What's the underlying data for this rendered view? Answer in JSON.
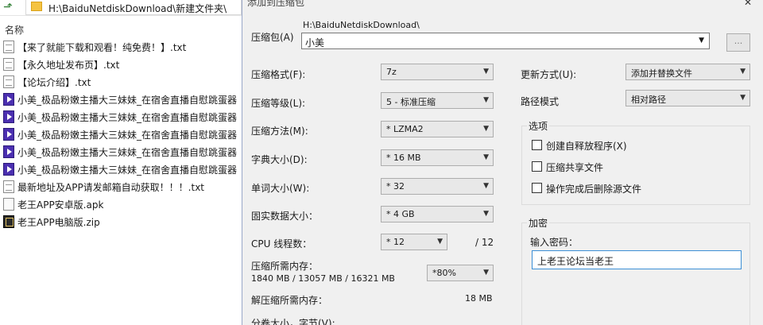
{
  "explorer": {
    "address_path": "H:\\BaiduNetdiskDownload\\新建文件夹\\",
    "column_name": "名称",
    "files": [
      {
        "name": "【来了就能下载和观看！纯免费！】.txt",
        "icon": "txt"
      },
      {
        "name": "【永久地址发布页】.txt",
        "icon": "txt"
      },
      {
        "name": "【论坛介绍】.txt",
        "icon": "txt"
      },
      {
        "name": "小美_极品粉嫩主播大三妹妹_在宿舍直播自慰跳蛋器",
        "icon": "video"
      },
      {
        "name": "小美_极品粉嫩主播大三妹妹_在宿舍直播自慰跳蛋器",
        "icon": "video"
      },
      {
        "name": "小美_极品粉嫩主播大三妹妹_在宿舍直播自慰跳蛋器",
        "icon": "video"
      },
      {
        "name": "小美_极品粉嫩主播大三妹妹_在宿舍直播自慰跳蛋器",
        "icon": "video"
      },
      {
        "name": "小美_极品粉嫩主播大三妹妹_在宿舍直播自慰跳蛋器",
        "icon": "video"
      },
      {
        "name": "最新地址及APP请发邮箱自动获取！！！.txt",
        "icon": "txt"
      },
      {
        "name": "老王APP安卓版.apk",
        "icon": "apk"
      },
      {
        "name": "老王APP电脑版.zip",
        "icon": "zip"
      }
    ]
  },
  "dialog": {
    "title": "添加到压缩包",
    "close_glyph": "✕",
    "archive_label": "压缩包(A)",
    "archive_dir": "H:\\BaiduNetdiskDownload\\",
    "archive_name": "小美",
    "browse_label": "...",
    "format_label": "压缩格式(F):",
    "format_value": "7z",
    "level_label": "压缩等级(L):",
    "level_value": "5 - 标准压缩",
    "method_label": "压缩方法(M):",
    "method_value": "* LZMA2",
    "dict_label": "字典大小(D):",
    "dict_value": "* 16 MB",
    "word_label": "单词大小(W):",
    "word_value": "* 32",
    "solid_label": "固实数据大小：",
    "solid_value": "* 4 GB",
    "cpu_label": "CPU 线程数：",
    "cpu_value": "* 12",
    "cpu_total": "/ 12",
    "mem_label": "压缩所需内存：",
    "mem_value": "1840 MB / 13057 MB / 16321 MB",
    "mem_pct": "*80%",
    "decomp_label": "解压缩所需内存：",
    "decomp_value": "18 MB",
    "split_label": "分卷大小，字节(V):",
    "update_label": "更新方式(U):",
    "update_value": "添加并替换文件",
    "path_label": "路径模式",
    "path_value": "相对路径",
    "options_title": "选项",
    "options": [
      "创建自释放程序(X)",
      "压缩共享文件",
      "操作完成后删除源文件"
    ],
    "encrypt_title": "加密",
    "password_label": "输入密码：",
    "password_value": "上老王论坛当老王"
  },
  "colors": {
    "accent": "#3c8fd6",
    "video_icon": "#4b2fb0",
    "dialog_bg": "#f0f0f0"
  }
}
